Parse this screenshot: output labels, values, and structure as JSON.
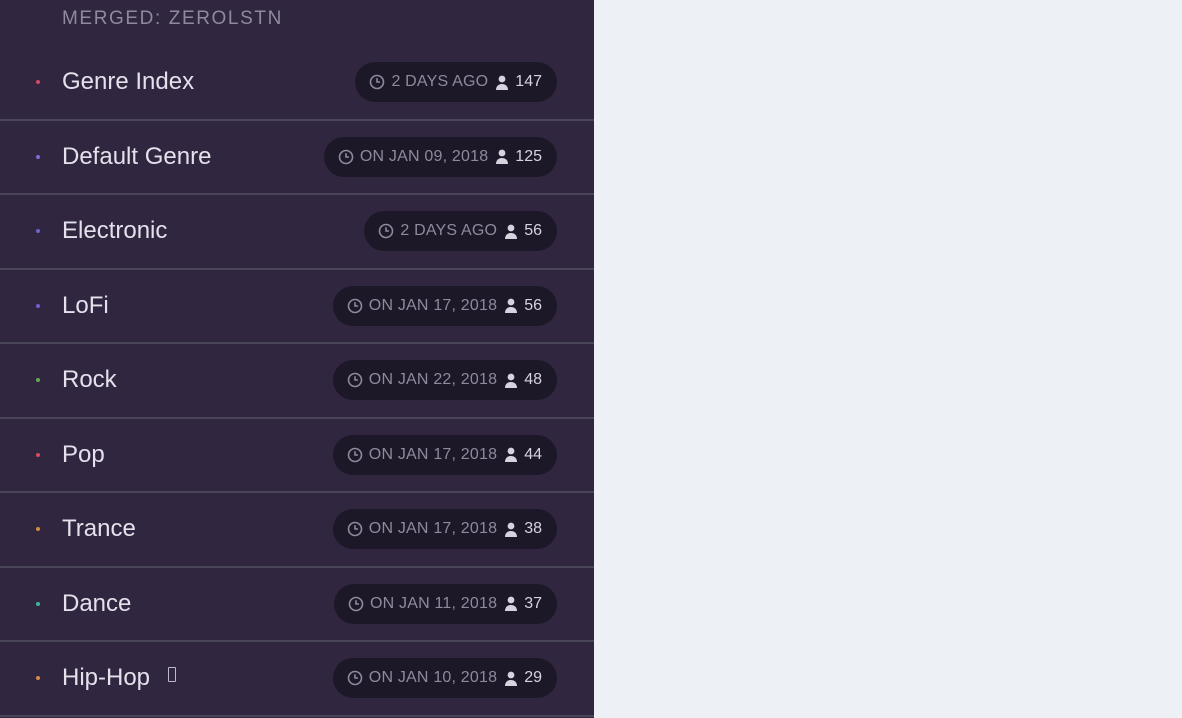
{
  "panel": {
    "header": "MERGED: ZEROLSTN",
    "items": [
      {
        "label": "Genre Index",
        "time": "2 DAYS AGO",
        "count": "147",
        "dot_color": "#d6486a"
      },
      {
        "label": "Default Genre",
        "time": "ON JAN 09, 2018",
        "count": "125",
        "dot_color": "#8b66d6"
      },
      {
        "label": "Electronic",
        "time": "2 DAYS AGO",
        "count": "56",
        "dot_color": "#6b66c9"
      },
      {
        "label": "LoFi",
        "time": "ON JAN 17, 2018",
        "count": "56",
        "dot_color": "#7a5cd1"
      },
      {
        "label": "Rock",
        "time": "ON JAN 22, 2018",
        "count": "48",
        "dot_color": "#5faa55"
      },
      {
        "label": "Pop",
        "time": "ON JAN 17, 2018",
        "count": "44",
        "dot_color": "#d64a5a"
      },
      {
        "label": "Trance",
        "time": "ON JAN 17, 2018",
        "count": "38",
        "dot_color": "#d48a3c"
      },
      {
        "label": "Dance",
        "time": "ON JAN 11, 2018",
        "count": "37",
        "dot_color": "#3cb59a"
      },
      {
        "label": "Hip-Hop",
        "time": "ON JAN 10, 2018",
        "count": "29",
        "dot_color": "#d8894a",
        "icon": "flag-icon"
      }
    ]
  },
  "colors": {
    "panel_bg": "#30263f",
    "badge_bg": "#1d1828",
    "page_bg": "#edf1f5"
  },
  "icons": {
    "time": "clock-icon",
    "count": "user-icon"
  }
}
